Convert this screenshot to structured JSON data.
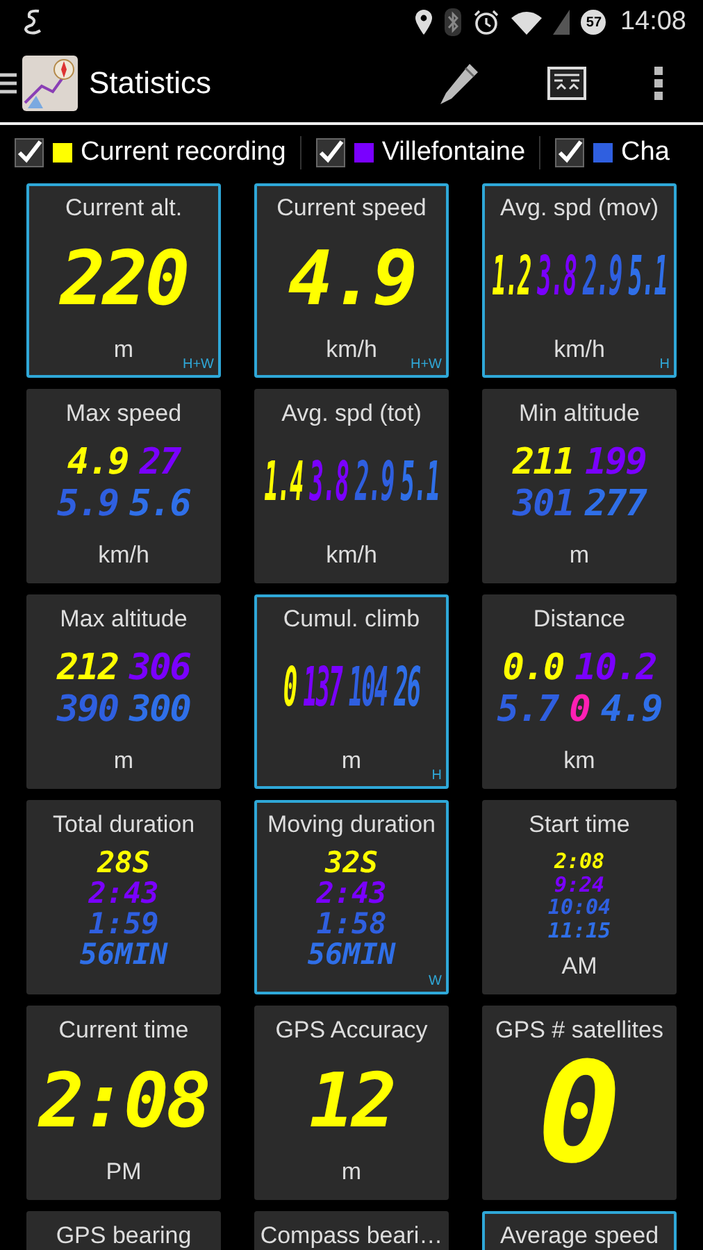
{
  "status_bar": {
    "battery": "57",
    "time": "14:08"
  },
  "action_bar": {
    "title": "Statistics"
  },
  "tracks": [
    {
      "label": "Current recording",
      "checked": true,
      "color": "#ffff00"
    },
    {
      "label": "Villefontaine",
      "checked": true,
      "color": "#7a00ff"
    },
    {
      "label": "Cha",
      "checked": true,
      "color": "#2f5fe0"
    }
  ],
  "tiles": [
    {
      "title": "Current alt.",
      "kind": "big",
      "highlighted": true,
      "lines": [
        [
          {
            "text": "220",
            "color": "#ffff00"
          }
        ]
      ],
      "unit": "m",
      "badge": "H+W"
    },
    {
      "title": "Current speed",
      "kind": "big",
      "highlighted": true,
      "lines": [
        [
          {
            "text": "4.9",
            "color": "#ffff00"
          }
        ]
      ],
      "unit": "km/h",
      "badge": "H+W"
    },
    {
      "title": "Avg. spd (mov)",
      "kind": "condensed",
      "highlighted": true,
      "lines": [
        [
          {
            "text": "1.2",
            "color": "#ffff00"
          },
          {
            "text": "3.8",
            "color": "#7a00ff"
          },
          {
            "text": "2.9",
            "color": "#2f5fe0"
          },
          {
            "text": "5.1",
            "color": "#2f6fe8"
          }
        ]
      ],
      "unit": "km/h",
      "badge": "H"
    },
    {
      "title": "Max speed",
      "kind": "medium",
      "highlighted": false,
      "lines": [
        [
          {
            "text": "4.9",
            "color": "#ffff00"
          },
          {
            "text": "27",
            "color": "#7a00ff"
          }
        ],
        [
          {
            "text": "5.9",
            "color": "#2f5fe0"
          },
          {
            "text": "5.6",
            "color": "#2f6fe8"
          }
        ]
      ],
      "unit": "km/h"
    },
    {
      "title": "Avg. spd (tot)",
      "kind": "condensed",
      "highlighted": false,
      "lines": [
        [
          {
            "text": "1.4",
            "color": "#ffff00"
          },
          {
            "text": "3.8",
            "color": "#7a00ff"
          },
          {
            "text": "2.9",
            "color": "#2f5fe0"
          },
          {
            "text": "5.1",
            "color": "#2f6fe8"
          }
        ]
      ],
      "unit": "km/h"
    },
    {
      "title": "Min altitude",
      "kind": "medium",
      "highlighted": false,
      "lines": [
        [
          {
            "text": "211",
            "color": "#ffff00"
          },
          {
            "text": "199",
            "color": "#7a00ff"
          }
        ],
        [
          {
            "text": "301",
            "color": "#2f5fe0"
          },
          {
            "text": "277",
            "color": "#2f6fe8"
          }
        ]
      ],
      "unit": "m"
    },
    {
      "title": "Max altitude",
      "kind": "medium",
      "highlighted": false,
      "lines": [
        [
          {
            "text": "212",
            "color": "#ffff00"
          },
          {
            "text": "306",
            "color": "#7a00ff"
          }
        ],
        [
          {
            "text": "390",
            "color": "#2f5fe0"
          },
          {
            "text": "300",
            "color": "#2f6fe8"
          }
        ]
      ],
      "unit": "m"
    },
    {
      "title": "Cumul. climb",
      "kind": "condensed",
      "highlighted": true,
      "lines": [
        [
          {
            "text": "0",
            "color": "#ffff00"
          },
          {
            "text": "137",
            "color": "#7a00ff"
          },
          {
            "text": "104",
            "color": "#2f5fe0"
          },
          {
            "text": "26",
            "color": "#2f6fe8"
          }
        ]
      ],
      "unit": "m",
      "badge": "H"
    },
    {
      "title": "Distance",
      "kind": "medium",
      "highlighted": false,
      "lines": [
        [
          {
            "text": "0.0",
            "color": "#ffff00"
          },
          {
            "text": "10.2",
            "color": "#7a00ff"
          }
        ],
        [
          {
            "text": "5.7",
            "color": "#2f5fe0"
          },
          {
            "text": "0",
            "color": "#ff1fb4"
          },
          {
            "text": "4.9",
            "color": "#2f6fe8"
          }
        ]
      ],
      "unit": "km"
    },
    {
      "title": "Total duration",
      "kind": "small",
      "highlighted": false,
      "lines": [
        [
          {
            "text": "28S",
            "color": "#ffff00"
          }
        ],
        [
          {
            "text": "2:43",
            "color": "#7a00ff"
          }
        ],
        [
          {
            "text": "1:59",
            "color": "#2f5fe0"
          }
        ],
        [
          {
            "text": "56MIN",
            "color": "#2f6fe8"
          }
        ]
      ]
    },
    {
      "title": "Moving duration",
      "kind": "small",
      "highlighted": true,
      "lines": [
        [
          {
            "text": "32S",
            "color": "#ffff00"
          }
        ],
        [
          {
            "text": "2:43",
            "color": "#7a00ff"
          }
        ],
        [
          {
            "text": "1:58",
            "color": "#2f5fe0"
          }
        ],
        [
          {
            "text": "56MIN",
            "color": "#2f6fe8"
          }
        ]
      ],
      "badge": "W"
    },
    {
      "title": "Start time",
      "kind": "tiny",
      "highlighted": false,
      "lines": [
        [
          {
            "text": "2:08",
            "color": "#ffff00"
          }
        ],
        [
          {
            "text": "9:24",
            "color": "#7a00ff"
          }
        ],
        [
          {
            "text": "10:04",
            "color": "#2f5fe0"
          }
        ],
        [
          {
            "text": "11:15",
            "color": "#2f6fe8"
          }
        ]
      ],
      "unit": "AM"
    },
    {
      "title": "Current time",
      "kind": "big",
      "highlighted": false,
      "lines": [
        [
          {
            "text": "2:08",
            "color": "#ffff00"
          }
        ]
      ],
      "unit": "PM"
    },
    {
      "title": "GPS Accuracy",
      "kind": "big",
      "highlighted": false,
      "lines": [
        [
          {
            "text": "12",
            "color": "#ffff00"
          }
        ]
      ],
      "unit": "m"
    },
    {
      "title": "GPS # satellites",
      "kind": "huge",
      "highlighted": false,
      "lines": [
        [
          {
            "text": "0",
            "color": "#ffff00"
          }
        ]
      ]
    },
    {
      "title": "GPS bearing",
      "kind": "big",
      "highlighted": false
    },
    {
      "title": "Compass beari…",
      "kind": "big",
      "highlighted": false
    },
    {
      "title": "Average speed",
      "kind": "big",
      "highlighted": true
    }
  ]
}
